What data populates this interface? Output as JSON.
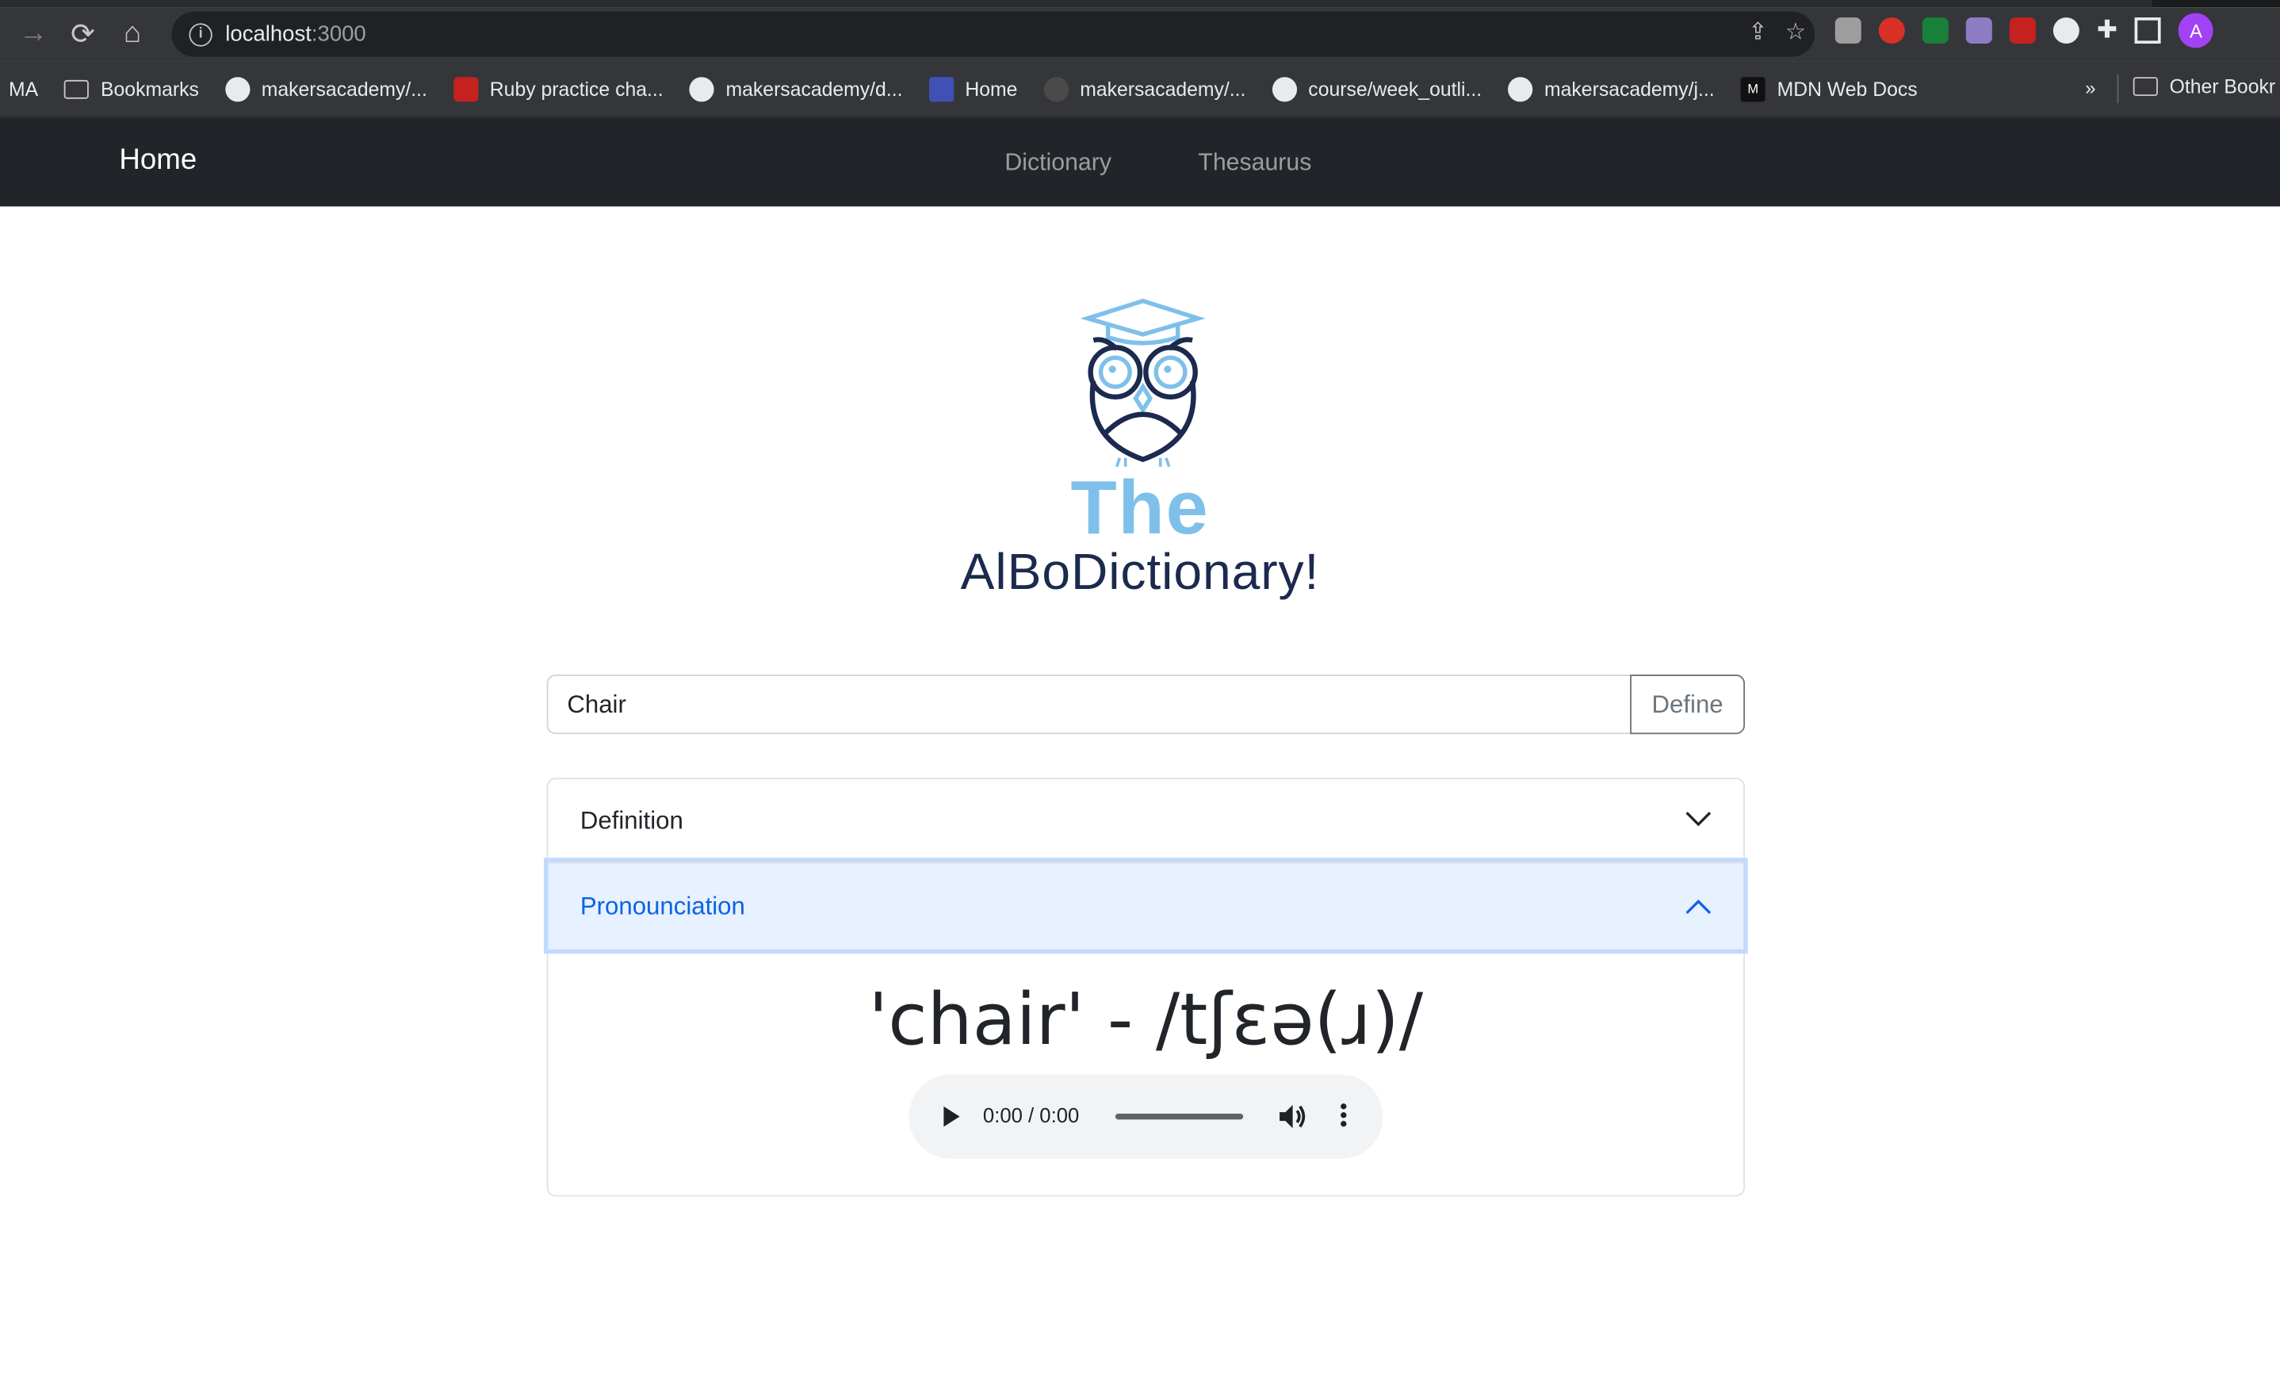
{
  "browser": {
    "url_host": "localhost",
    "url_port": ":3000",
    "profile_initial": "A",
    "bookmarks": [
      {
        "label": "MA",
        "icon": "none"
      },
      {
        "label": "Bookmarks",
        "icon": "folder-icon"
      },
      {
        "label": "makersacademy/...",
        "icon": "github-icon"
      },
      {
        "label": "Ruby practice cha...",
        "icon": "ruby-icon"
      },
      {
        "label": "makersacademy/d...",
        "icon": "github-icon"
      },
      {
        "label": "Home",
        "icon": "calendar-icon"
      },
      {
        "label": "makersacademy/...",
        "icon": "github-icon"
      },
      {
        "label": "course/week_outli...",
        "icon": "github-icon"
      },
      {
        "label": "makersacademy/j...",
        "icon": "github-icon"
      },
      {
        "label": "MDN Web Docs",
        "icon": "mdn-icon"
      }
    ],
    "bookmarks_more": "»",
    "other_bookmarks": "Other Bookr"
  },
  "navbar": {
    "brand": "Home",
    "links": [
      "Dictionary",
      "Thesaurus"
    ]
  },
  "logo": {
    "line1": "The",
    "line2": "AlBoDictionary!"
  },
  "search": {
    "value": "Chair",
    "button": "Define"
  },
  "accordion": {
    "items": [
      {
        "label": "Definition",
        "expanded": false
      },
      {
        "label": "Pronounciation",
        "expanded": true
      }
    ],
    "pronunciation_text": "'chair' - /tʃɛə(ɹ)/"
  },
  "audio": {
    "time": "0:00 / 0:00"
  },
  "colors": {
    "navbar_bg": "#212529",
    "accent_blue": "#0c63e4",
    "logo_light_blue": "#7fc0ea",
    "logo_navy": "#1b2a4e"
  }
}
